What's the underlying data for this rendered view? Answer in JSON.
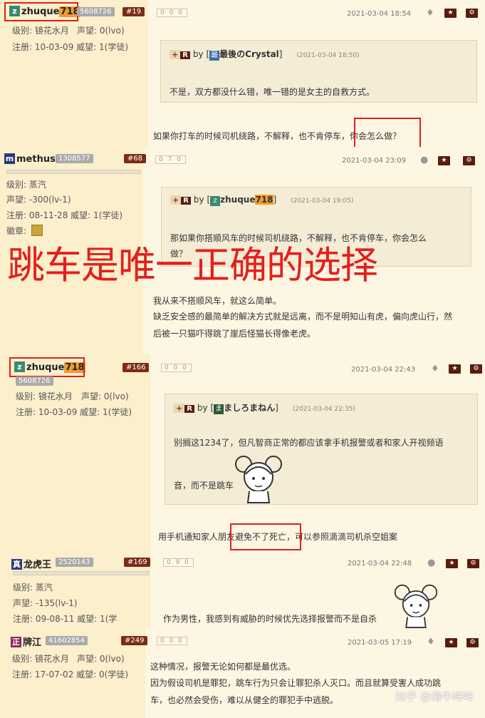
{
  "posts": [
    {
      "user": "zhuque718",
      "user_prefix": "zhuque",
      "user_hl": "718",
      "avatar_char": "z",
      "avatar_color": "#3a8a6e",
      "uid": "5608726",
      "floor": "#19",
      "counter": "0 0 0",
      "level": "级别: 镜花水月",
      "rep": "声望: 0(lvo)",
      "reg": "注册: 10-03-09 威望: 1(学徒)",
      "time": "2021-03-04 18:54",
      "quote": {
        "plus": "+",
        "r": "R",
        "by": "by",
        "name": "最後のCrystal",
        "icon": "最",
        "icon_color": "#3a6ea5",
        "time": "(2021-03-04 18:50)",
        "text": "不是，双方都没什么错，唯一错的是女主的自救方式。"
      },
      "body": "如果你打车的时候司机绕路，不解释，也不肯停车，你会怎么做？"
    },
    {
      "user": "methuss",
      "avatar_char": "m",
      "avatar_color": "#2a3a7a",
      "uid": "1308577",
      "floor": "#68",
      "counter": "0 7 0",
      "level": "级别: 蒸汽",
      "rep": "声望: -300(lv-1)",
      "reg": "注册: 08-11-28 威望: 1(学徒)",
      "medal": "徽章:",
      "time": "2021-03-04 23:09",
      "quote": {
        "plus": "+",
        "r": "R",
        "by": "by",
        "name_prefix": "zhuque",
        "name_hl": "718",
        "icon": "z",
        "icon_color": "#3a8a6e",
        "time": "(2021-03-04 19:05)",
        "text1": "那如果你搭顺风车的时候司机绕路，不解释，也不肯停车，你会怎么",
        "text2": "做？"
      },
      "body1": "我从来不搭顺风车，就这么简单。",
      "body2": "缺乏安全感的最简单的解决方式就是远离，而不是明知山有虎，偏向虎山行，然",
      "body3": "后被一只猫吓得跳了崖后怪猫长得像老虎。"
    },
    {
      "user_prefix": "zhuque",
      "user_hl": "718",
      "avatar_char": "z",
      "avatar_color": "#3a8a6e",
      "uid": "5608726",
      "floor": "#166",
      "counter": "0 0 0",
      "level": "级别: 镜花水月",
      "rep": "声望: 0(lvo)",
      "reg": "注册: 10-03-09 威望: 1(学徒)",
      "time": "2021-03-04 22:43",
      "quote": {
        "plus": "+",
        "r": "R",
        "by": "by",
        "name": "ましろまねん",
        "icon": "ま",
        "icon_color": "#2a5a3a",
        "time": "(2021-03-04 22:35)",
        "text1": "别搁这1234了，但凡智商正常的都应该拿手机报警或者和家人开视频语",
        "text2": "音，而不是跳车"
      },
      "body": "用手机通知家人朋友避免不了死亡，可以参照滴滴司机杀空姐案"
    },
    {
      "user": "龙虎王",
      "avatar_char": "真",
      "avatar_color": "#2a3a7a",
      "uid": "2520143",
      "floor": "#169",
      "counter": "0 9 0",
      "level": "级别: 蒸汽",
      "rep": "声望: -135(lv-1)",
      "reg": "注册: 09-08-11 威望: 1(学",
      "time": "2021-03-04 22:48",
      "body": "作为男性，我感到有威胁的时候优先选择报警而不是自杀"
    },
    {
      "user": "牌江",
      "avatar_char": "正",
      "avatar_color": "#8a2a5a",
      "uid": "41602854",
      "floor": "#249",
      "counter": "0 0 0",
      "level": "级别: 镜花水月",
      "rep": "声望: 0(lvo)",
      "reg": "注册: 17-07-02 威望: 0(学徒)",
      "time": "2021-03-05 17:19",
      "body1": "这种情况，报警无论如何都是最优选。",
      "body2": "因为假设司机是罪犯，跳车行为只会让罪犯杀人灭口。而且就算受害人成功跳",
      "body3": "车，也必然会受伤，难以从健全的罪犯手中逃脱。"
    }
  ],
  "overlay_text": "跳车是唯一正确的选择",
  "watermark": "知乎 @海牛哞哞",
  "icons": {
    "android": "android-icon",
    "apple": "apple-icon",
    "star": "star-button",
    "gear": "gear-button"
  }
}
